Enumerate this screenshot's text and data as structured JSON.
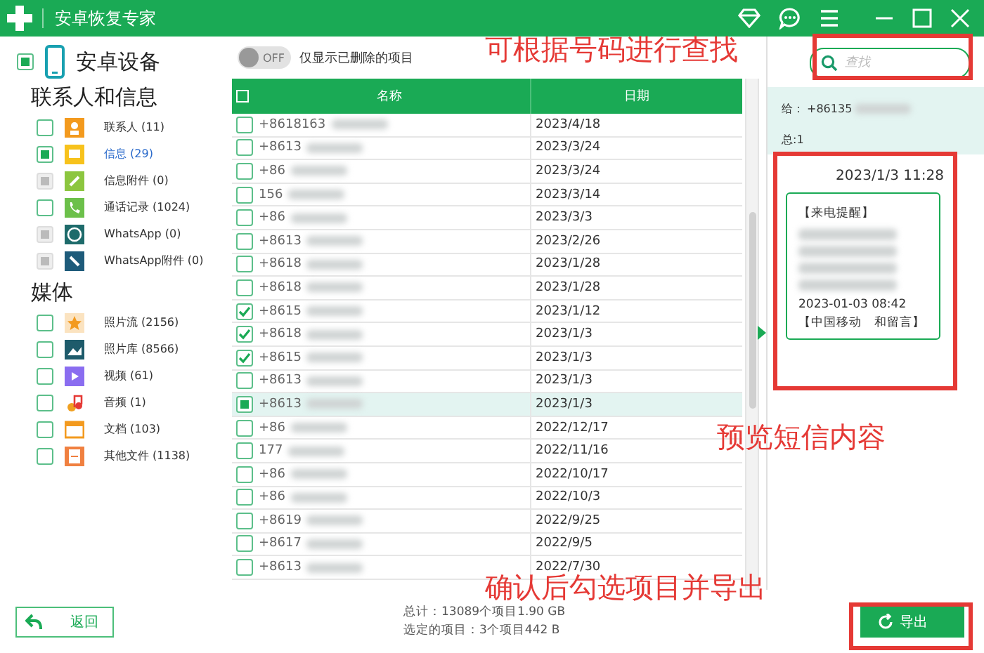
{
  "window": {
    "title": "安卓恢复专家"
  },
  "device": {
    "label": "安卓设备",
    "checked": false,
    "partial": true,
    "disabled": false
  },
  "sections": [
    {
      "title": "联系人和信息",
      "items": [
        {
          "label": "联系人 (11)",
          "checked": false,
          "partial": false,
          "disabled": false,
          "selected": false
        },
        {
          "label": "信息 (29)",
          "checked": false,
          "partial": true,
          "disabled": false,
          "selected": true
        },
        {
          "label": "信息附件 (0)",
          "checked": false,
          "partial": false,
          "disabled": true,
          "selected": false
        },
        {
          "label": "通话记录 (1024)",
          "checked": false,
          "partial": false,
          "disabled": false,
          "selected": false
        },
        {
          "label": "WhatsApp (0)",
          "checked": false,
          "partial": false,
          "disabled": true,
          "selected": false
        },
        {
          "label": "WhatsApp附件 (0)",
          "checked": false,
          "partial": false,
          "disabled": true,
          "selected": false
        }
      ]
    },
    {
      "title": "媒体",
      "items": [
        {
          "label": "照片流 (2156)",
          "checked": false,
          "partial": false,
          "disabled": false,
          "selected": false
        },
        {
          "label": "照片库 (8566)",
          "checked": false,
          "partial": false,
          "disabled": false,
          "selected": false
        },
        {
          "label": "视频 (61)",
          "checked": false,
          "partial": false,
          "disabled": false,
          "selected": false
        },
        {
          "label": "音频 (1)",
          "checked": false,
          "partial": false,
          "disabled": false,
          "selected": false
        },
        {
          "label": "文档 (103)",
          "checked": false,
          "partial": false,
          "disabled": false,
          "selected": false
        },
        {
          "label": "其他文件 (1138)",
          "checked": false,
          "partial": false,
          "disabled": false,
          "selected": false
        }
      ]
    }
  ],
  "filter": {
    "toggle": "OFF",
    "on": false,
    "label": "仅显示已删除的项目"
  },
  "table": {
    "columns": [
      "名称",
      "日期"
    ],
    "header_checked": false,
    "rows": [
      {
        "name": "+8618163",
        "date": "2023/4/18",
        "checked": false,
        "partial": false,
        "selected": false
      },
      {
        "name": "+8613",
        "date": "2023/3/24",
        "checked": false,
        "partial": false,
        "selected": false
      },
      {
        "name": "+86",
        "date": "2023/3/24",
        "checked": false,
        "partial": false,
        "selected": false
      },
      {
        "name": "156",
        "date": "2023/3/14",
        "checked": false,
        "partial": false,
        "selected": false
      },
      {
        "name": "+86",
        "date": "2023/3/3",
        "checked": false,
        "partial": false,
        "selected": false
      },
      {
        "name": "+8613",
        "date": "2023/2/26",
        "checked": false,
        "partial": false,
        "selected": false
      },
      {
        "name": "+8618",
        "date": "2023/1/28",
        "checked": false,
        "partial": false,
        "selected": false
      },
      {
        "name": "+8618",
        "date": "2023/1/28",
        "checked": false,
        "partial": false,
        "selected": false
      },
      {
        "name": "+8615",
        "date": "2023/1/12",
        "checked": true,
        "partial": false,
        "selected": false
      },
      {
        "name": "+8618",
        "date": "2023/1/3",
        "checked": true,
        "partial": false,
        "selected": false
      },
      {
        "name": "+8615",
        "date": "2023/1/3",
        "checked": true,
        "partial": false,
        "selected": false
      },
      {
        "name": "+8613",
        "date": "2023/1/3",
        "checked": false,
        "partial": false,
        "selected": false
      },
      {
        "name": "+8613",
        "date": "2023/1/3",
        "checked": false,
        "partial": true,
        "selected": true
      },
      {
        "name": "+86",
        "date": "2022/12/17",
        "checked": false,
        "partial": false,
        "selected": false
      },
      {
        "name": "177",
        "date": "2022/11/16",
        "checked": false,
        "partial": false,
        "selected": false
      },
      {
        "name": "+86",
        "date": "2022/10/17",
        "checked": false,
        "partial": false,
        "selected": false
      },
      {
        "name": "+86",
        "date": "2022/10/3",
        "checked": false,
        "partial": false,
        "selected": false
      },
      {
        "name": "+8619",
        "date": "2022/9/25",
        "checked": false,
        "partial": false,
        "selected": false
      },
      {
        "name": "+8617",
        "date": "2022/9/5",
        "checked": false,
        "partial": false,
        "selected": false
      },
      {
        "name": "+8613",
        "date": "2022/7/30",
        "checked": false,
        "partial": false,
        "selected": false
      }
    ]
  },
  "search": {
    "placeholder": "查找"
  },
  "preview": {
    "to_label": "给：",
    "to_number": "+86135",
    "total": "总:1",
    "time": "2023/1/3 11:28",
    "lines": [
      {
        "kind": "text",
        "text": "【来电提醒】"
      },
      {
        "kind": "blurred"
      },
      {
        "kind": "blurred"
      },
      {
        "kind": "blurred"
      },
      {
        "kind": "blurred"
      },
      {
        "kind": "text",
        "text": "2023-01-03 08:42"
      },
      {
        "kind": "text",
        "text": "【中国移动　和留言】"
      }
    ]
  },
  "summary": {
    "total": "总计：13089个项目1.90 GB",
    "selected": "选定的项目：3个项目442 B"
  },
  "buttons": {
    "back": "返回",
    "export": "导出"
  },
  "annotations": [
    {
      "kind": "search",
      "text": "可根据号码进行查找"
    },
    {
      "kind": "preview",
      "text": "预览短信内容"
    },
    {
      "kind": "export",
      "text": "确认后勾选项目并导出"
    }
  ]
}
